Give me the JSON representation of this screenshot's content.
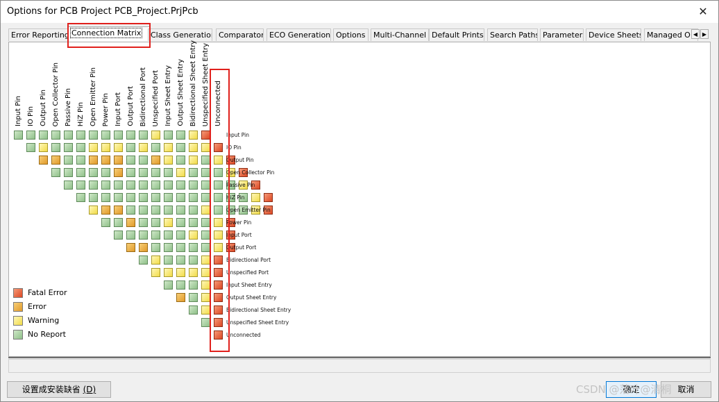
{
  "window": {
    "title": "Options for PCB Project PCB_Project.PrjPcb",
    "close_glyph": "✕"
  },
  "tabs": [
    "Error Reporting",
    "Connection Matrix",
    "Class Generation",
    "Comparator",
    "ECO Generation",
    "Options",
    "Multi-Channel",
    "Default Prints",
    "Search Paths",
    "Parameters",
    "Device Sheets",
    "Managed O"
  ],
  "active_tab": 1,
  "tab_scroll": {
    "left": "◀",
    "right": "▶"
  },
  "matrix": {
    "columns": [
      "Input Pin",
      "IO Pin",
      "Output Pin",
      "Open Collector Pin",
      "Passive Pin",
      "HiZ Pin",
      "Open Emitter Pin",
      "Power Pin",
      "Input Port",
      "Output Port",
      "Bidirectional Port",
      "Unspecified Port",
      "Input Sheet Entry",
      "Output Sheet Entry",
      "Bidirectional Sheet Entry",
      "Unspecified Sheet Entry",
      "Unconnected"
    ],
    "rows": [
      "Input Pin",
      "IO Pin",
      "Output Pin",
      "Open Collector Pin",
      "Passive Pin",
      "HiZ Pin",
      "Open Emitter Pin",
      "Power Pin",
      "Input Port",
      "Output Port",
      "Bidirectional Port",
      "Unspecified Port",
      "Input Sheet Entry",
      "Output Sheet Entry",
      "Bidirectional Sheet Entry",
      "Unspecified Sheet Entry",
      "Unconnected"
    ],
    "cells": [
      [
        "N",
        "N",
        "N",
        "N",
        "N",
        "N",
        "N",
        "N",
        "N",
        "N",
        "N",
        "W",
        "N",
        "N",
        "W",
        "F"
      ],
      [
        "N",
        "W",
        "N",
        "N",
        "N",
        "W",
        "W",
        "W",
        "N",
        "W",
        "N",
        "W",
        "N",
        "W",
        "W",
        "F"
      ],
      [
        "E",
        "E",
        "N",
        "N",
        "E",
        "E",
        "E",
        "N",
        "N",
        "E",
        "W",
        "N",
        "W",
        "N",
        "W",
        "F"
      ],
      [
        "N",
        "N",
        "N",
        "N",
        "N",
        "E",
        "N",
        "N",
        "N",
        "N",
        "W",
        "N",
        "N",
        "N",
        "W",
        "F"
      ],
      [
        "N",
        "N",
        "N",
        "N",
        "N",
        "N",
        "N",
        "N",
        "N",
        "N",
        "N",
        "N",
        "N",
        "N",
        "W",
        "F"
      ],
      [
        "N",
        "N",
        "N",
        "N",
        "N",
        "N",
        "N",
        "N",
        "N",
        "N",
        "N",
        "N",
        "N",
        "N",
        "W",
        "F"
      ],
      [
        "W",
        "E",
        "E",
        "N",
        "N",
        "N",
        "N",
        "N",
        "N",
        "W",
        "N",
        "N",
        "N",
        "W",
        "F"
      ],
      [
        "N",
        "N",
        "E",
        "N",
        "N",
        "W",
        "N",
        "N",
        "N",
        "W",
        "F"
      ],
      [
        "N",
        "N",
        "N",
        "N",
        "N",
        "N",
        "W",
        "N",
        "W",
        "F"
      ],
      [
        "E",
        "E",
        "N",
        "N",
        "N",
        "N",
        "N",
        "W",
        "F"
      ],
      [
        "N",
        "W",
        "N",
        "N",
        "N",
        "W",
        "F"
      ],
      [
        "W",
        "W",
        "W",
        "W",
        "W",
        "F"
      ],
      [
        "N",
        "N",
        "N",
        "W",
        "F"
      ],
      [
        "E",
        "N",
        "W",
        "F"
      ],
      [
        "N",
        "W",
        "F"
      ],
      [
        "N",
        "F"
      ],
      [
        "F"
      ]
    ]
  },
  "legend": [
    {
      "label": "Fatal Error",
      "level": "F"
    },
    {
      "label": "Error",
      "level": "E"
    },
    {
      "label": "Warning",
      "level": "W"
    },
    {
      "label": "No Report",
      "level": "N"
    }
  ],
  "buttons": {
    "defaults": "设置成安装缺省",
    "defaults_key": "(D)",
    "ok": "确定",
    "cancel": "取消"
  },
  "watermark": "CSDN @落叶@清桐"
}
